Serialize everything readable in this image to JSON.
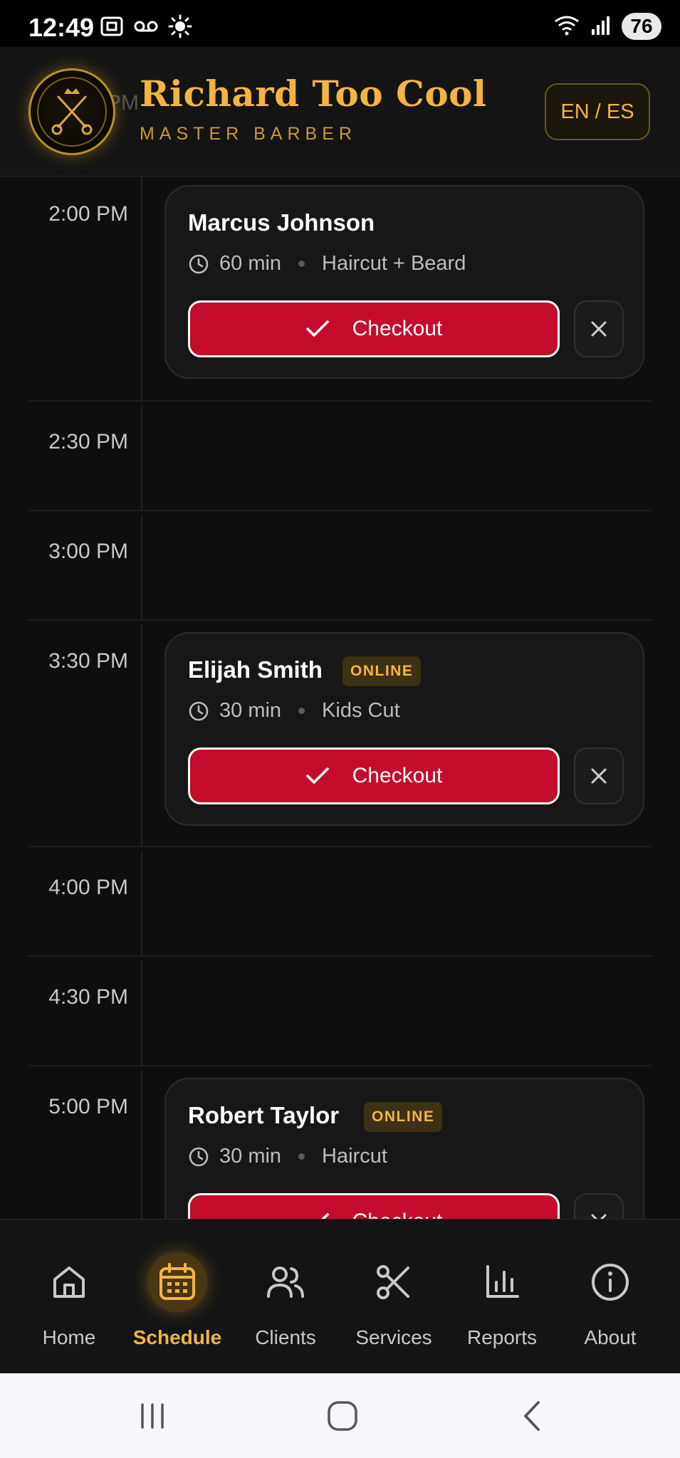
{
  "status_bar": {
    "time": "12:49",
    "battery": "76"
  },
  "header": {
    "ghost_time": "PM",
    "title": "Richard Too Cool",
    "subtitle": "MASTER BARBER",
    "lang_toggle": "EN / ES",
    "logo_text": "RICHARD TOO COOL · MASTER BARBER"
  },
  "schedule": {
    "slots": [
      "2:00 PM",
      "2:30 PM",
      "3:00 PM",
      "3:30 PM",
      "4:00 PM",
      "4:30 PM",
      "5:00 PM"
    ],
    "appointments": [
      {
        "name": "Marcus Johnson",
        "duration": "60 min",
        "service": "Haircut + Beard",
        "badge": "",
        "checkout": "Checkout"
      },
      {
        "name": "Elijah Smith",
        "duration": "30 min",
        "service": "Kids Cut",
        "badge": "ONLINE",
        "checkout": "Checkout"
      },
      {
        "name": "Robert Taylor",
        "duration": "30 min",
        "service": "Haircut",
        "badge": "ONLINE",
        "checkout": "Checkout"
      }
    ]
  },
  "nav": {
    "active": "Schedule",
    "items": [
      {
        "label": "Home",
        "icon": "home-icon"
      },
      {
        "label": "Schedule",
        "icon": "calendar-icon"
      },
      {
        "label": "Clients",
        "icon": "users-icon"
      },
      {
        "label": "Services",
        "icon": "scissors-icon"
      },
      {
        "label": "Reports",
        "icon": "bar-chart-icon"
      },
      {
        "label": "About",
        "icon": "info-icon"
      }
    ]
  },
  "colors": {
    "accent": "#f2b540",
    "checkout": "#c40d2c",
    "background": "#0e0e0e"
  }
}
